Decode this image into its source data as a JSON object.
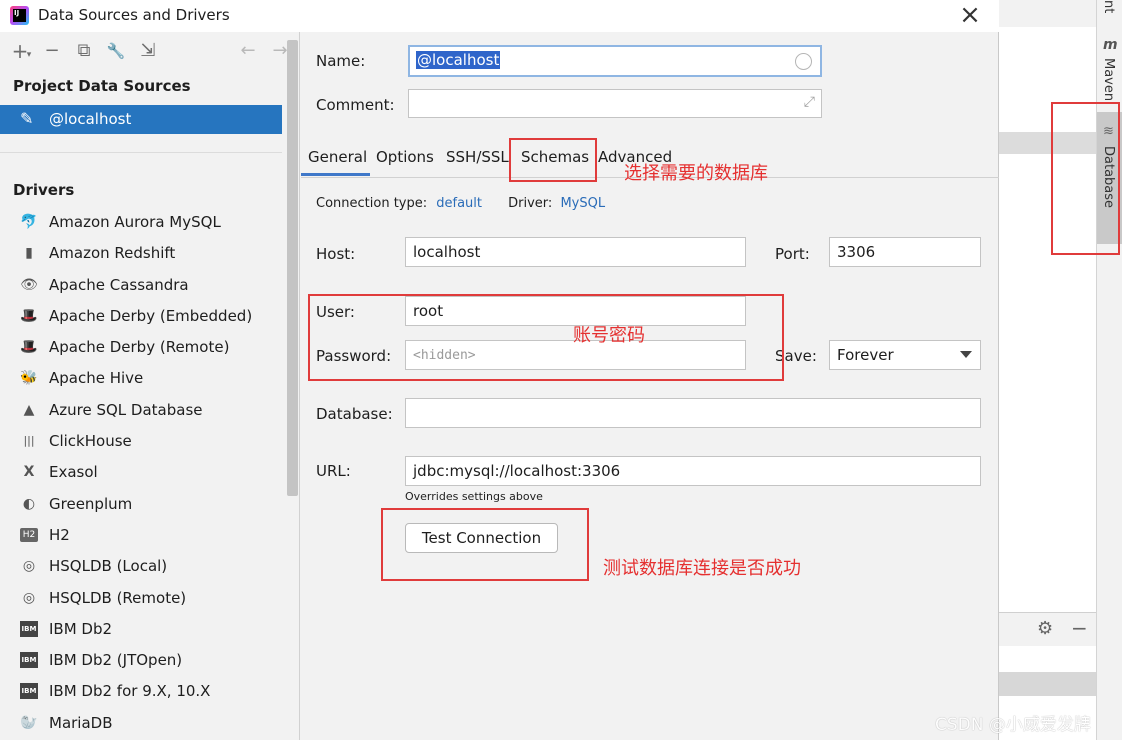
{
  "window": {
    "title": "Data Sources and Drivers",
    "close": "×"
  },
  "toolbar": {
    "add": "+",
    "add_chevron": "▾",
    "remove": "−",
    "copy": "⧉",
    "settings": "🔧",
    "import": "⇲",
    "back": "←",
    "forward": "→"
  },
  "left": {
    "project_header": "Project Data Sources",
    "selected_source": "@localhost",
    "drivers_header": "Drivers",
    "drivers": [
      {
        "label": "Amazon Aurora MySQL",
        "icon": "🐬"
      },
      {
        "label": "Amazon Redshift",
        "icon": "▮"
      },
      {
        "label": "Apache Cassandra",
        "icon": "👁"
      },
      {
        "label": "Apache Derby (Embedded)",
        "icon": "🎩"
      },
      {
        "label": "Apache Derby (Remote)",
        "icon": "🎩"
      },
      {
        "label": "Apache Hive",
        "icon": "🐝"
      },
      {
        "label": "Azure SQL Database",
        "icon": "▲"
      },
      {
        "label": "ClickHouse",
        "icon": "|||"
      },
      {
        "label": "Exasol",
        "icon": "X"
      },
      {
        "label": "Greenplum",
        "icon": "◐"
      },
      {
        "label": "H2",
        "icon": "H2"
      },
      {
        "label": "HSQLDB (Local)",
        "icon": "◎"
      },
      {
        "label": "HSQLDB (Remote)",
        "icon": "◎"
      },
      {
        "label": "IBM Db2",
        "icon": "IBM"
      },
      {
        "label": "IBM Db2 (JTOpen)",
        "icon": "IBM"
      },
      {
        "label": "IBM Db2 for 9.X, 10.X",
        "icon": "IBM"
      },
      {
        "label": "MariaDB",
        "icon": "🦭"
      }
    ]
  },
  "form": {
    "name_label": "Name:",
    "name_value": "@localhost",
    "comment_label": "Comment:",
    "comment_value": "",
    "tabs": [
      "General",
      "Options",
      "SSH/SSL",
      "Schemas",
      "Advanced"
    ],
    "active_tab": "General",
    "connection_type_label": "Connection type:",
    "connection_type_value": "default",
    "driver_label": "Driver:",
    "driver_value": "MySQL",
    "host_label": "Host:",
    "host_value": "localhost",
    "port_label": "Port:",
    "port_value": "3306",
    "user_label": "User:",
    "user_value": "root",
    "password_label": "Password:",
    "password_value": "<hidden>",
    "save_label": "Save:",
    "save_value": "Forever",
    "database_label": "Database:",
    "database_value": "",
    "url_label": "URL:",
    "url_value": "jdbc:mysql://localhost:3306",
    "url_hint": "Overrides settings above",
    "test_button": "Test Connection"
  },
  "annotations": {
    "schemas_note": "选择需要的数据库",
    "credentials_note": "账号密码",
    "test_note": "测试数据库连接是否成功"
  },
  "ide": {
    "tab_nt": "nt",
    "maven_label": "Maven",
    "maven_icon": "m",
    "database_label": "Database",
    "database_icon": "≋"
  },
  "watermark": "CSDN @小威爱发牌"
}
